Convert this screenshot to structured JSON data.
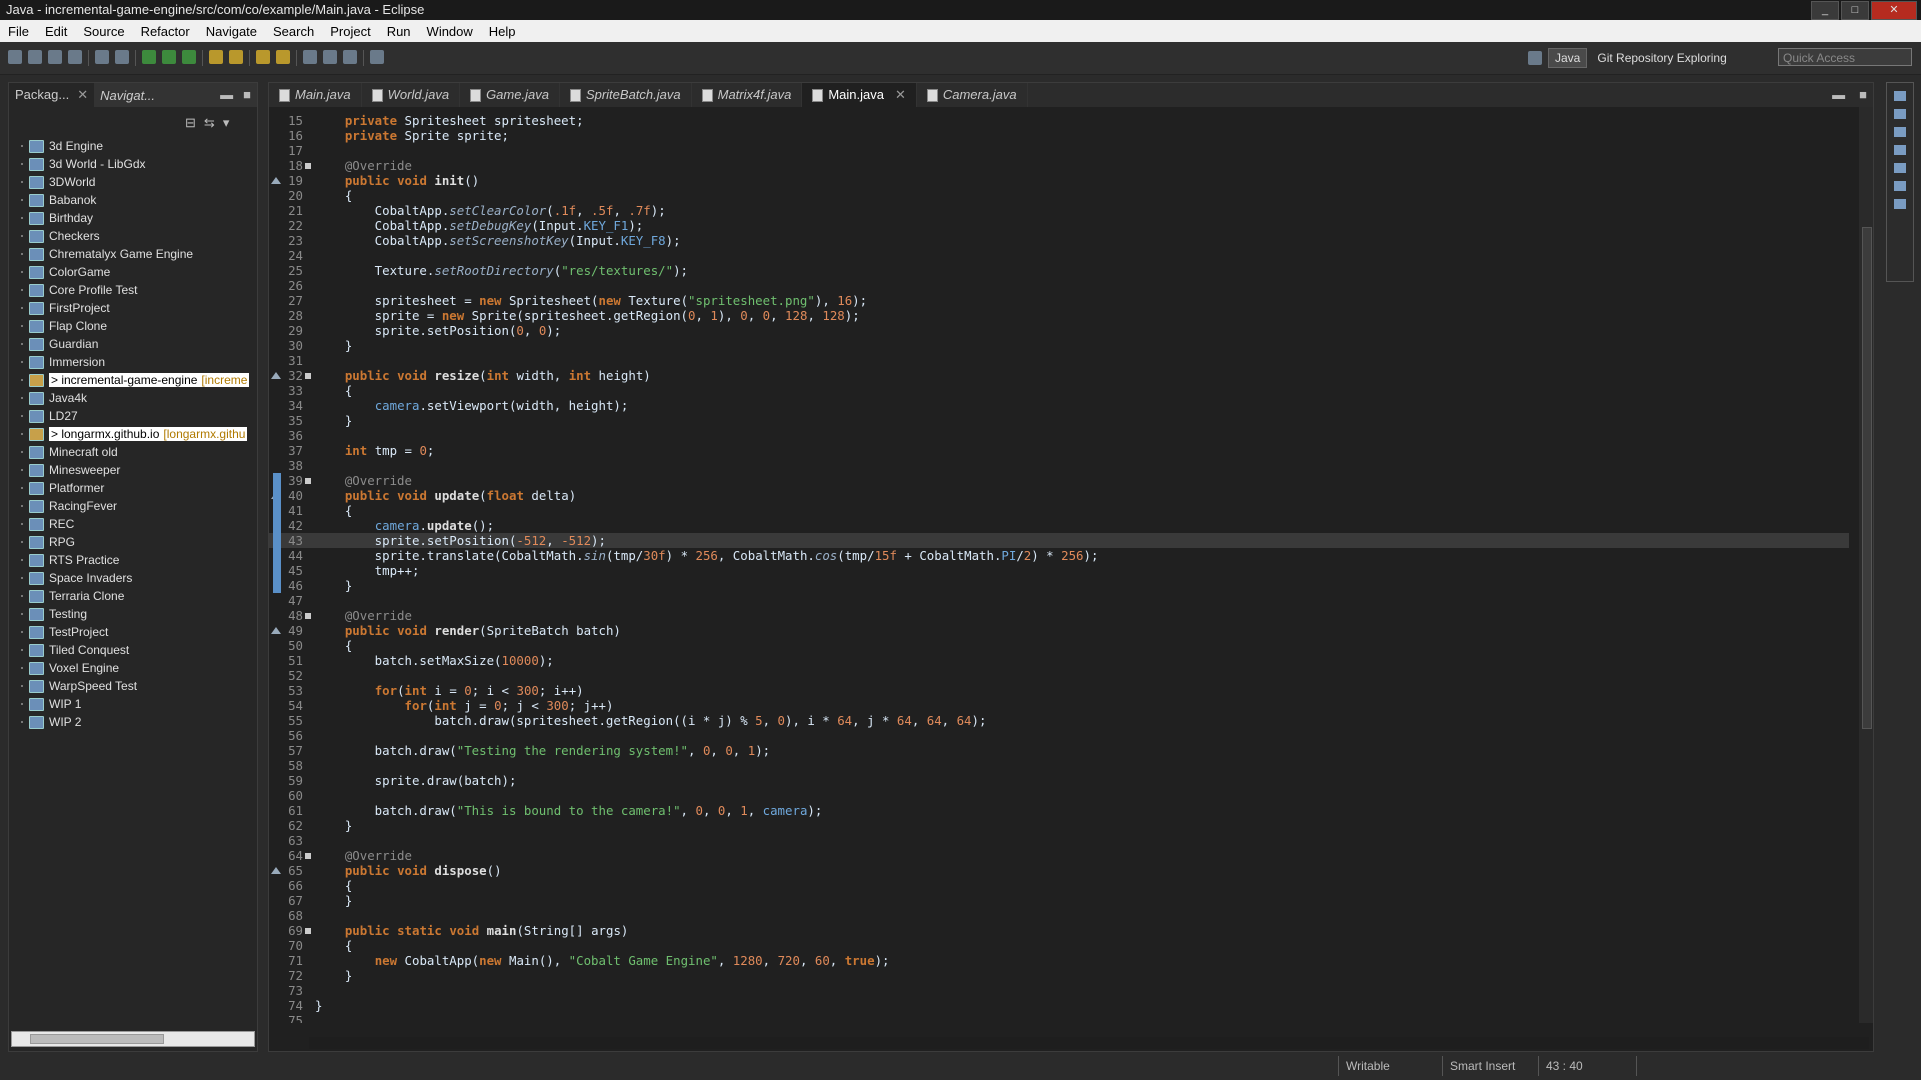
{
  "window": {
    "title": "Java - incremental-game-engine/src/com/co/example/Main.java - Eclipse"
  },
  "menu": [
    "File",
    "Edit",
    "Source",
    "Refactor",
    "Navigate",
    "Search",
    "Project",
    "Run",
    "Window",
    "Help"
  ],
  "perspectives": {
    "java": "Java",
    "git": "Git Repository Exploring",
    "quick_access_placeholder": "Quick Access"
  },
  "left_panel": {
    "tabs": [
      {
        "label": "Packag...",
        "active": true
      },
      {
        "label": "Navigat...",
        "active": false
      }
    ],
    "projects": [
      {
        "name": "3d Engine"
      },
      {
        "name": "3d World - LibGdx"
      },
      {
        "name": "3DWorld"
      },
      {
        "name": "Babanok"
      },
      {
        "name": "Birthday"
      },
      {
        "name": "Checkers"
      },
      {
        "name": "Chrematalyx Game Engine"
      },
      {
        "name": "ColorGame"
      },
      {
        "name": "Core Profile Test"
      },
      {
        "name": "FirstProject"
      },
      {
        "name": "Flap Clone"
      },
      {
        "name": "Guardian"
      },
      {
        "name": "Immersion"
      },
      {
        "name": "> incremental-game-engine",
        "branch": "[increme",
        "git": true,
        "highlight": true
      },
      {
        "name": "Java4k"
      },
      {
        "name": "LD27"
      },
      {
        "name": "> longarmx.github.io",
        "branch": "[longarmx.githu",
        "git": true,
        "highlight": true
      },
      {
        "name": "Minecraft old"
      },
      {
        "name": "Minesweeper"
      },
      {
        "name": "Platformer"
      },
      {
        "name": "RacingFever"
      },
      {
        "name": "REC"
      },
      {
        "name": "RPG"
      },
      {
        "name": "RTS Practice"
      },
      {
        "name": "Space Invaders"
      },
      {
        "name": "Terraria Clone"
      },
      {
        "name": "Testing"
      },
      {
        "name": "TestProject"
      },
      {
        "name": "Tiled Conquest"
      },
      {
        "name": "Voxel Engine"
      },
      {
        "name": "WarpSpeed Test"
      },
      {
        "name": "WIP 1"
      },
      {
        "name": "WIP 2"
      }
    ]
  },
  "editor": {
    "tabs": [
      {
        "label": "Main.java",
        "active": false
      },
      {
        "label": "World.java",
        "active": false
      },
      {
        "label": "Game.java",
        "active": false
      },
      {
        "label": "SpriteBatch.java",
        "active": false
      },
      {
        "label": "Matrix4f.java",
        "active": false
      },
      {
        "label": "Main.java",
        "active": true
      },
      {
        "label": "Camera.java",
        "active": false
      }
    ],
    "current_line": 43,
    "lines": [
      {
        "n": 15,
        "code": "    private Spritesheet spritesheet;"
      },
      {
        "n": 16,
        "code": "    private Sprite sprite;"
      },
      {
        "n": 17,
        "code": ""
      },
      {
        "n": 18,
        "code": "    @Override",
        "fold": true
      },
      {
        "n": 19,
        "code": "    public void init()",
        "ov": true
      },
      {
        "n": 20,
        "code": "    {"
      },
      {
        "n": 21,
        "code": "        CobaltApp.setClearColor(.1f, .5f, .7f);"
      },
      {
        "n": 22,
        "code": "        CobaltApp.setDebugKey(Input.KEY_F1);"
      },
      {
        "n": 23,
        "code": "        CobaltApp.setScreenshotKey(Input.KEY_F8);"
      },
      {
        "n": 24,
        "code": ""
      },
      {
        "n": 25,
        "code": "        Texture.setRootDirectory(\"res/textures/\");"
      },
      {
        "n": 26,
        "code": ""
      },
      {
        "n": 27,
        "code": "        spritesheet = new Spritesheet(new Texture(\"spritesheet.png\"), 16);"
      },
      {
        "n": 28,
        "code": "        sprite = new Sprite(spritesheet.getRegion(0, 1), 0, 0, 128, 128);"
      },
      {
        "n": 29,
        "code": "        sprite.setPosition(0, 0);"
      },
      {
        "n": 30,
        "code": "    }"
      },
      {
        "n": 31,
        "code": ""
      },
      {
        "n": 32,
        "code": "    public void resize(int width, int height)",
        "fold": true,
        "ov": true
      },
      {
        "n": 33,
        "code": "    {"
      },
      {
        "n": 34,
        "code": "        camera.setViewport(width, height);"
      },
      {
        "n": 35,
        "code": "    }"
      },
      {
        "n": 36,
        "code": ""
      },
      {
        "n": 37,
        "code": "    int tmp = 0;"
      },
      {
        "n": 38,
        "code": ""
      },
      {
        "n": 39,
        "code": "    @Override",
        "fold": true
      },
      {
        "n": 40,
        "code": "    public void update(float delta)",
        "ov": true
      },
      {
        "n": 41,
        "code": "    {"
      },
      {
        "n": 42,
        "code": "        camera.update();"
      },
      {
        "n": 43,
        "code": "        sprite.setPosition(-512, -512);"
      },
      {
        "n": 44,
        "code": "        sprite.translate(CobaltMath.sin(tmp/30f) * 256, CobaltMath.cos(tmp/15f + CobaltMath.PI/2) * 256);"
      },
      {
        "n": 45,
        "code": "        tmp++;"
      },
      {
        "n": 46,
        "code": "    }"
      },
      {
        "n": 47,
        "code": ""
      },
      {
        "n": 48,
        "code": "    @Override",
        "fold": true
      },
      {
        "n": 49,
        "code": "    public void render(SpriteBatch batch)",
        "ov": true
      },
      {
        "n": 50,
        "code": "    {"
      },
      {
        "n": 51,
        "code": "        batch.setMaxSize(10000);"
      },
      {
        "n": 52,
        "code": ""
      },
      {
        "n": 53,
        "code": "        for(int i = 0; i < 300; i++)"
      },
      {
        "n": 54,
        "code": "            for(int j = 0; j < 300; j++)"
      },
      {
        "n": 55,
        "code": "                batch.draw(spritesheet.getRegion((i * j) % 5, 0), i * 64, j * 64, 64, 64);"
      },
      {
        "n": 56,
        "code": ""
      },
      {
        "n": 57,
        "code": "        batch.draw(\"Testing the rendering system!\", 0, 0, 1);"
      },
      {
        "n": 58,
        "code": ""
      },
      {
        "n": 59,
        "code": "        sprite.draw(batch);"
      },
      {
        "n": 60,
        "code": ""
      },
      {
        "n": 61,
        "code": "        batch.draw(\"This is bound to the camera!\", 0, 0, 1, camera);"
      },
      {
        "n": 62,
        "code": "    }"
      },
      {
        "n": 63,
        "code": ""
      },
      {
        "n": 64,
        "code": "    @Override",
        "fold": true
      },
      {
        "n": 65,
        "code": "    public void dispose()",
        "ov": true
      },
      {
        "n": 66,
        "code": "    {"
      },
      {
        "n": 67,
        "code": "    }"
      },
      {
        "n": 68,
        "code": ""
      },
      {
        "n": 69,
        "code": "    public static void main(String[] args)",
        "fold": true
      },
      {
        "n": 70,
        "code": "    {"
      },
      {
        "n": 71,
        "code": "        new CobaltApp(new Main(), \"Cobalt Game Engine\", 1280, 720, 60, true);"
      },
      {
        "n": 72,
        "code": "    }"
      },
      {
        "n": 73,
        "code": ""
      },
      {
        "n": 74,
        "code": "}"
      },
      {
        "n": 75,
        "code": ""
      }
    ]
  },
  "status": {
    "mode": "Writable",
    "insert": "Smart Insert",
    "position": "43 : 40"
  }
}
